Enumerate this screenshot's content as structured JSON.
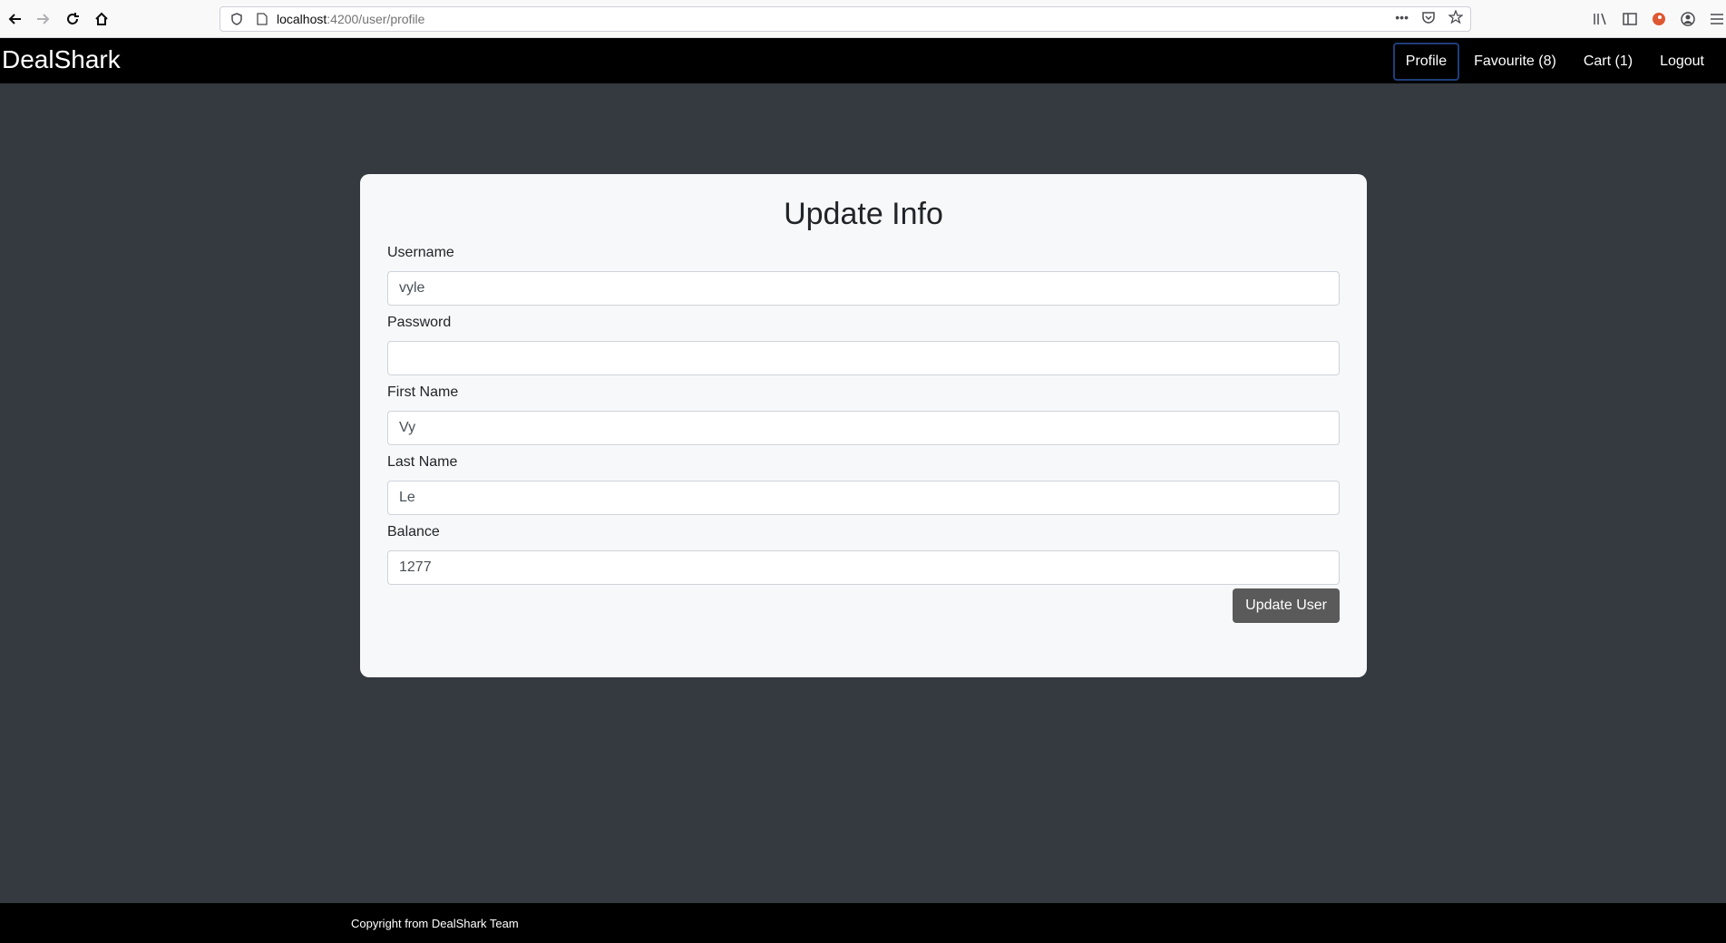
{
  "browser": {
    "url_host": "localhost",
    "url_path": ":4200/user/profile"
  },
  "app": {
    "brand": "DealShark",
    "nav": [
      {
        "label": "Profile"
      },
      {
        "label": "Favourite (8)"
      },
      {
        "label": "Cart (1)"
      },
      {
        "label": "Logout"
      }
    ]
  },
  "form": {
    "title": "Update Info",
    "fields": [
      {
        "label": "Username",
        "value": "vyle"
      },
      {
        "label": "Password",
        "value": ""
      },
      {
        "label": "First Name",
        "value": "Vy"
      },
      {
        "label": "Last Name",
        "value": "Le"
      },
      {
        "label": "Balance",
        "value": "1277"
      }
    ],
    "submit_label": "Update User"
  },
  "footer": {
    "text": "Copyright from DealShark Team"
  }
}
